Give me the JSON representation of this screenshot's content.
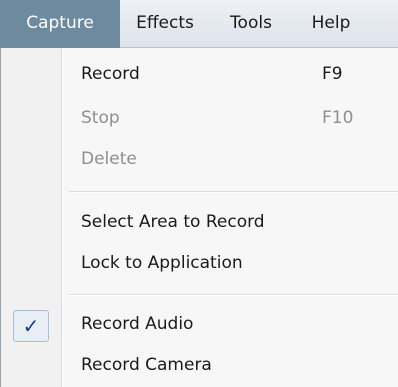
{
  "menubar": {
    "items": [
      {
        "label": "Capture",
        "active": true
      },
      {
        "label": "Effects",
        "active": false
      },
      {
        "label": "Tools",
        "active": false
      },
      {
        "label": "Help",
        "active": false
      }
    ]
  },
  "capture_menu": {
    "items": [
      {
        "label": "Record",
        "shortcut": "F9",
        "enabled": true
      },
      {
        "label": "Stop",
        "shortcut": "F10",
        "enabled": false
      },
      {
        "label": "Delete",
        "enabled": false
      },
      {
        "label": "Select Area to Record",
        "enabled": true
      },
      {
        "label": "Lock to Application",
        "enabled": true
      },
      {
        "label": "Record Audio",
        "enabled": true,
        "checked": true,
        "check_glyph": "✓"
      },
      {
        "label": "Record Camera",
        "enabled": true
      }
    ]
  },
  "colors": {
    "active_menu_bg": "#6d8a9f",
    "disabled_text": "#8f8f8f",
    "check_color": "#1b3d8f"
  }
}
